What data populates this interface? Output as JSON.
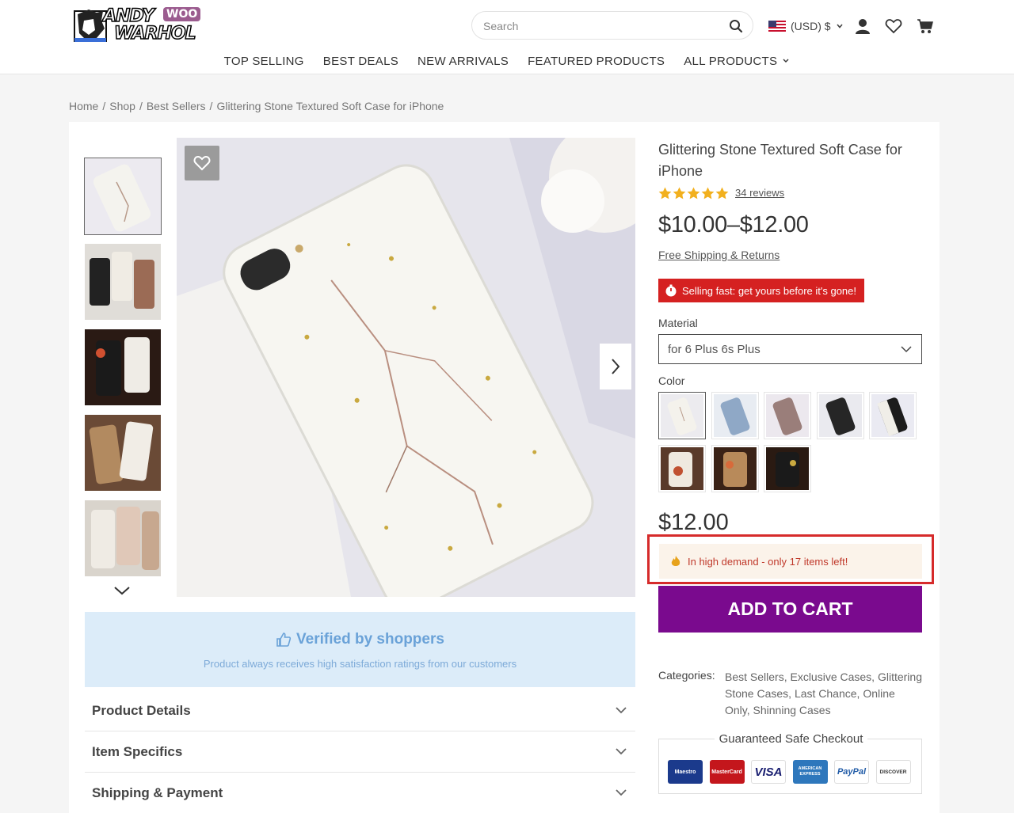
{
  "header": {
    "logo": {
      "line1": "ANDY",
      "line2": "WARHOL",
      "badge": "WOO"
    },
    "search_placeholder": "Search",
    "currency": "(USD) $",
    "nav": [
      "TOP SELLING",
      "BEST DEALS",
      "NEW ARRIVALS",
      "FEATURED PRODUCTS",
      "ALL PRODUCTS"
    ]
  },
  "breadcrumb": [
    "Home",
    "Shop",
    "Best Sellers",
    "Glittering Stone Textured Soft Case for iPhone"
  ],
  "product": {
    "title": "Glittering Stone Textured Soft Case for iPhone",
    "rating": 5,
    "reviews": "34 reviews",
    "price_range": "$10.00–$12.00",
    "shipping_link": "Free Shipping & Returns",
    "selling_fast": "Selling fast: get yours before it's gone!",
    "material_label": "Material",
    "material_value": "for 6 Plus 6s Plus",
    "color_label": "Color",
    "price": "$12.00",
    "demand": "In high demand - only 17 items left!",
    "add_to_cart": "ADD TO CART",
    "categories_label": "Categories:",
    "categories": "Best Sellers, Exclusive Cases, Glittering Stone Cases, Last Chance, Online Only, Shinning Cases",
    "checkout_title": "Guaranteed Safe Checkout",
    "payment_cards": [
      "Maestro",
      "MasterCard",
      "VISA",
      "AMERICAN EXPRESS",
      "PayPal",
      "DISCOVER"
    ]
  },
  "verified": {
    "title": "Verified by shoppers",
    "subtitle": "Product always receives high satisfaction ratings from our customers"
  },
  "accordions": [
    "Product Details",
    "Item Specifics",
    "Shipping & Payment"
  ],
  "colors": {
    "accent_purple": "#7a0a8e",
    "alert_red": "#d52121",
    "star_gold": "#f2b01e"
  }
}
